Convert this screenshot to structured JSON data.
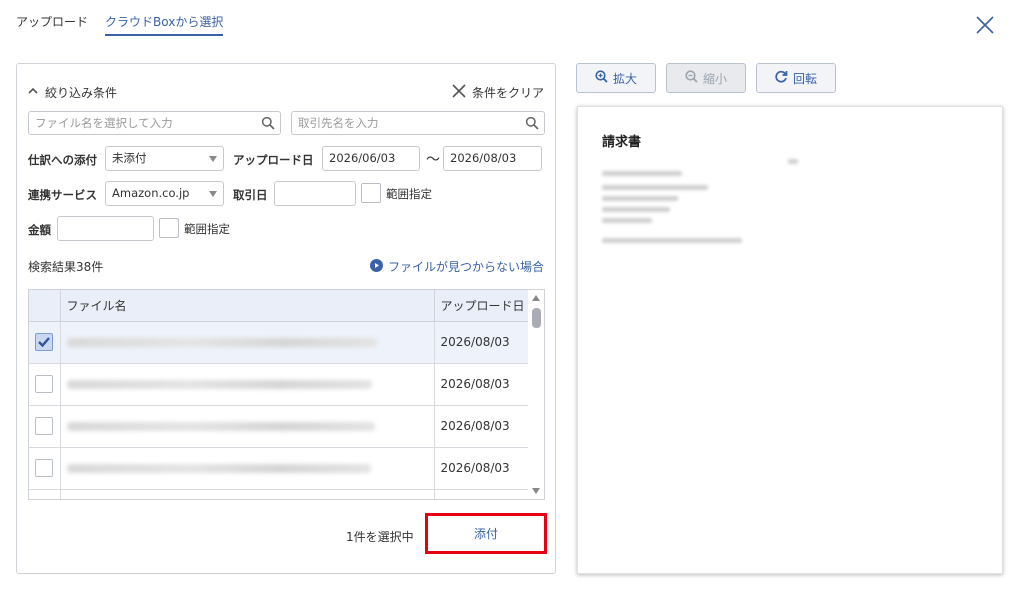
{
  "tabs": [
    {
      "label": "アップロード",
      "active": false
    },
    {
      "label": "クラウドBoxから選択",
      "active": true
    }
  ],
  "filter": {
    "title": "絞り込み条件",
    "clear_label": "条件をクリア",
    "filename_placeholder": "ファイル名を選択して入力",
    "partner_placeholder": "取引先名を入力",
    "attach_label": "仕訳への添付",
    "attach_value": "未添付",
    "upload_date_label": "アップロード日",
    "upload_date_from": "2026/06/03",
    "date_sep": "〜",
    "upload_date_to": "2026/08/03",
    "service_label": "連携サービス",
    "service_value": "Amazon.co.jp",
    "txn_date_label": "取引日",
    "txn_date_value": "",
    "range_label": "範囲指定",
    "amount_label": "金額",
    "amount_value": "",
    "amount_range_label": "範囲指定"
  },
  "results": {
    "count_text": "検索結果38件",
    "help_link": "ファイルが見つからない場合"
  },
  "table": {
    "columns": [
      "ファイル名",
      "アップロード日"
    ],
    "rows": [
      {
        "checked": true,
        "date": "2026/08/03"
      },
      {
        "checked": false,
        "date": "2026/08/03"
      },
      {
        "checked": false,
        "date": "2026/08/03"
      },
      {
        "checked": false,
        "date": "2026/08/03"
      }
    ]
  },
  "footer": {
    "selected_text": "1件を選択中",
    "attach_button": "添付"
  },
  "toolbar": {
    "zoom_in": "拡大",
    "zoom_out": "縮小",
    "rotate": "回転"
  },
  "preview": {
    "title": "請求書"
  },
  "colors": {
    "accent": "#3a62a8",
    "highlight": "#e60012",
    "header_bg": "#e9eef8"
  }
}
